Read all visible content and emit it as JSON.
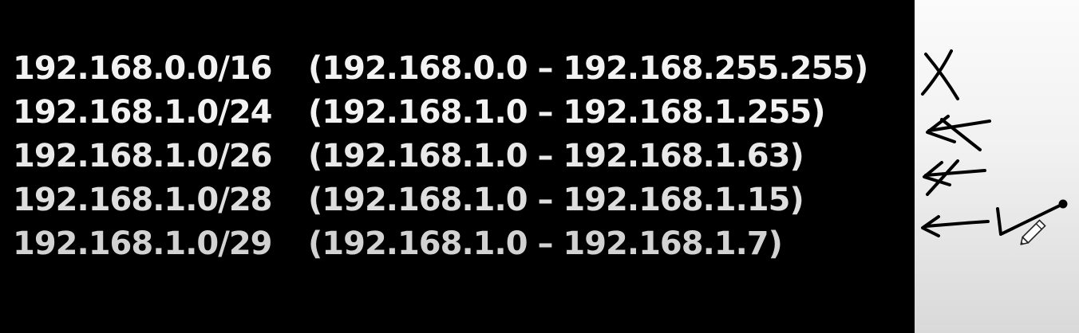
{
  "slide": {
    "rows": [
      {
        "cidr": "192.168.0.0/16",
        "range": "(192.168.0.0 – 192.168.255.255)"
      },
      {
        "cidr": "192.168.1.0/24",
        "range": "(192.168.1.0 – 192.168.1.255)"
      },
      {
        "cidr": "192.168.1.0/26",
        "range": "(192.168.1.0 – 192.168.1.63)"
      },
      {
        "cidr": "192.168.1.0/28",
        "range": "(192.168.1.0 – 192.168.1.15)"
      },
      {
        "cidr": "192.168.1.0/29",
        "range": "(192.168.1.0 – 192.168.1.7)"
      }
    ]
  },
  "annotations": {
    "marks": [
      "cross-mark",
      "crossed-arrow",
      "crossed-arrow",
      "arrow-check"
    ],
    "cursor": "pencil-icon",
    "ink_color": "#000000"
  },
  "colors": {
    "slide_background": "#000000",
    "text": "#f2f2f2",
    "annotation_background": "#f1f1f1"
  }
}
